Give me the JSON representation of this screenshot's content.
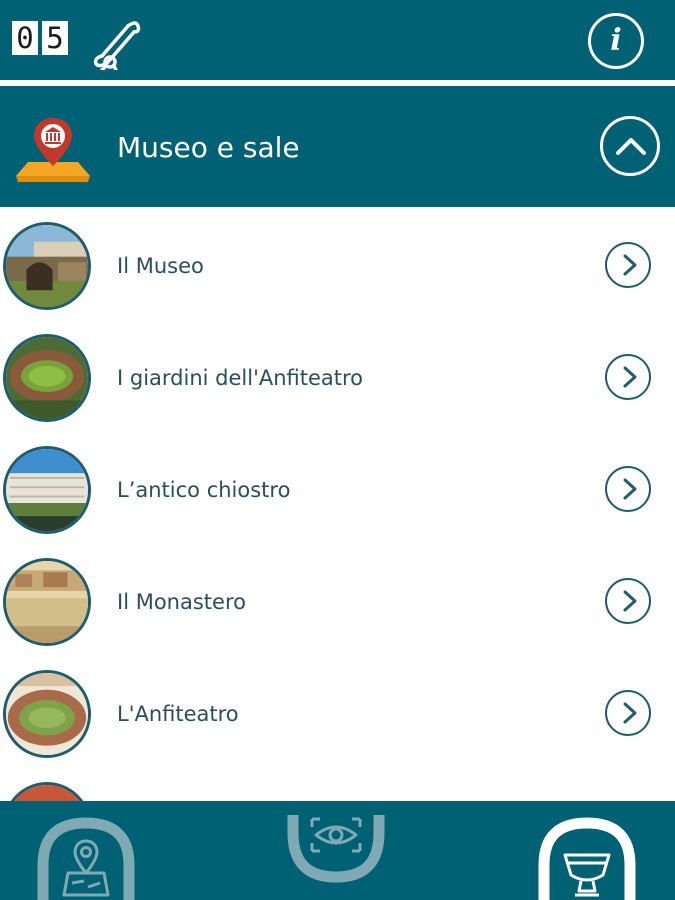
{
  "topbar": {
    "counter_digits": [
      "0",
      "5"
    ],
    "scroll_icon": "scroll-icon",
    "info_label": "i"
  },
  "section": {
    "title": "Museo e sale",
    "icon": "museum-location-icon",
    "collapse_icon": "chevron-up-icon"
  },
  "items": [
    {
      "label": "Il Museo"
    },
    {
      "label": "I giardini dell'Anfiteatro"
    },
    {
      "label": "L’antico chiostro"
    },
    {
      "label": "Il Monastero"
    },
    {
      "label": "L'Anfiteatro"
    }
  ],
  "bottom_nav": [
    {
      "icon": "map-location-icon",
      "active": false
    },
    {
      "icon": "eye-icon",
      "active": false
    },
    {
      "icon": "vase-icon",
      "active": true
    }
  ],
  "colors": {
    "primary": "#006174",
    "white": "#ffffff",
    "text": "#2b4e5c",
    "outline": "#1f5c6e",
    "accent_orange": "#f5a623",
    "accent_red": "#c0392b"
  }
}
